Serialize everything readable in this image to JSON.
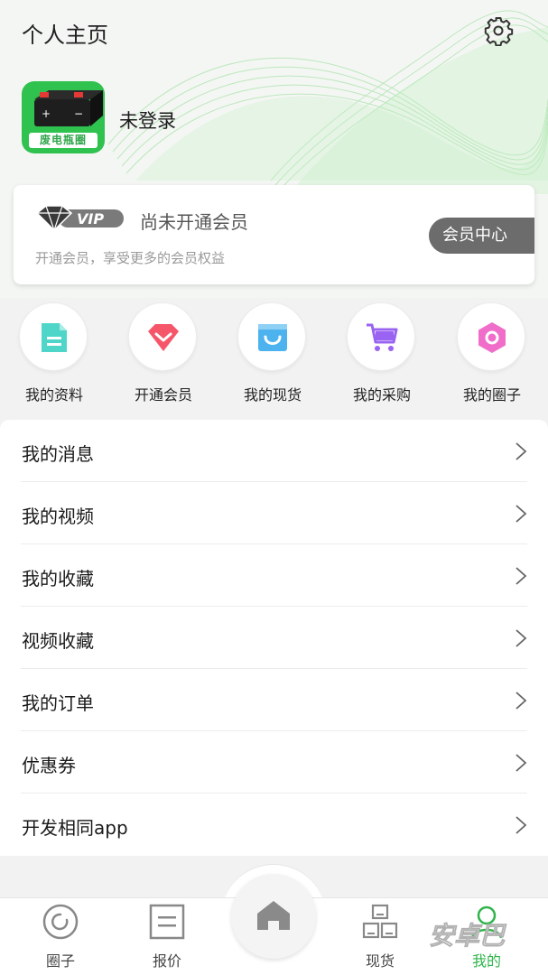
{
  "header": {
    "title": "个人主页"
  },
  "profile": {
    "logo_caption": "废电瓶圈",
    "status": "未登录"
  },
  "vip": {
    "badge_text": "VIP",
    "title": "尚未开通会员",
    "description": "开通会员，享受更多的会员权益",
    "center_button": "会员中心"
  },
  "quick_actions": [
    {
      "label": "我的资料",
      "icon": "document-icon",
      "color": "#4fd6c9"
    },
    {
      "label": "开通会员",
      "icon": "diamond-icon",
      "color": "#f5566a"
    },
    {
      "label": "我的现货",
      "icon": "shopping-bag-icon",
      "color": "#4cb3ee"
    },
    {
      "label": "我的采购",
      "icon": "cart-icon",
      "color": "#9a63f1"
    },
    {
      "label": "我的圈子",
      "icon": "hexagon-icon",
      "color": "#f06ec9"
    }
  ],
  "menu": [
    {
      "label": "我的消息"
    },
    {
      "label": "我的视频"
    },
    {
      "label": "我的收藏"
    },
    {
      "label": "视频收藏"
    },
    {
      "label": "我的订单"
    },
    {
      "label": "优惠券"
    },
    {
      "label": "开发相同app"
    }
  ],
  "tabbar": {
    "tabs": [
      {
        "label": "圈子",
        "icon": "circle-icon"
      },
      {
        "label": "报价",
        "icon": "quote-icon"
      },
      {
        "label": "",
        "icon": "home-icon"
      },
      {
        "label": "现货",
        "icon": "boxes-icon"
      },
      {
        "label": "我的",
        "icon": "user-icon",
        "active": true
      }
    ]
  },
  "watermark": "安卓巴",
  "colors": {
    "accent": "#2fb44b",
    "menu_text": "#1a1a1a",
    "member_button": "#6c6c6c"
  }
}
